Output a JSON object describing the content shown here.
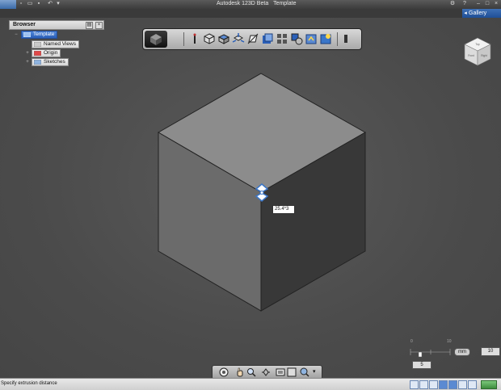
{
  "window": {
    "app_name": "Autodesk 123D Beta",
    "doc_name": "Template"
  },
  "header": {
    "gallery_label": "Gallery"
  },
  "browser": {
    "title": "Browser",
    "items": [
      {
        "label": "Template",
        "selected": true
      },
      {
        "label": "Named Views",
        "selected": false
      },
      {
        "label": "Origin",
        "selected": false
      },
      {
        "label": "Sketches",
        "selected": false
      }
    ]
  },
  "viewport": {
    "dimension_value": "25.4*3"
  },
  "viewcube": {
    "top": "Top",
    "front": "Front",
    "right": "Right"
  },
  "scale": {
    "unit": "mm",
    "value_right": "10",
    "value_bottom": "5",
    "tick_left": "0",
    "tick_right": "10"
  },
  "status": {
    "prompt": "Specify extrusion distance"
  },
  "colors": {
    "accent": "#2a5fb8",
    "cube_top": "#8c8c8c",
    "cube_left": "#6b6b6b",
    "cube_right": "#383838"
  }
}
